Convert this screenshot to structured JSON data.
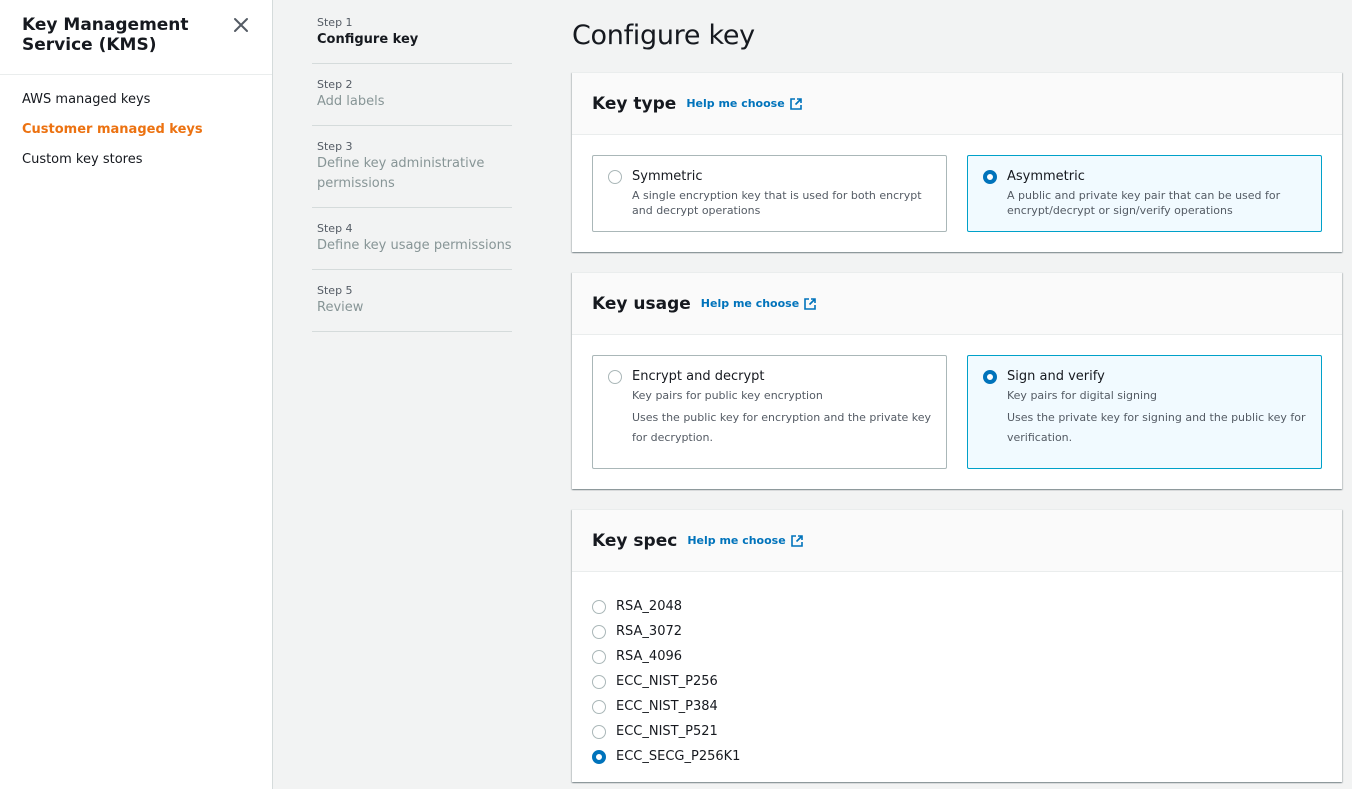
{
  "sidebar": {
    "title": "Key Management Service (KMS)",
    "items": [
      {
        "label": "AWS managed keys",
        "active": false
      },
      {
        "label": "Customer managed keys",
        "active": true
      },
      {
        "label": "Custom key stores",
        "active": false
      }
    ],
    "close_icon": "close-icon"
  },
  "steps": [
    {
      "num": "Step 1",
      "label": "Configure key",
      "current": true
    },
    {
      "num": "Step 2",
      "label": "Add labels",
      "current": false
    },
    {
      "num": "Step 3",
      "label": "Define key administrative permissions",
      "current": false
    },
    {
      "num": "Step 4",
      "label": "Define key usage permissions",
      "current": false
    },
    {
      "num": "Step 5",
      "label": "Review",
      "current": false
    }
  ],
  "page_title": "Configure key",
  "key_type": {
    "title": "Key type",
    "help": "Help me choose",
    "options": [
      {
        "title": "Symmetric",
        "desc": "A single encryption key that is used for both encrypt and decrypt operations",
        "selected": false
      },
      {
        "title": "Asymmetric",
        "desc": "A public and private key pair that can be used for encrypt/decrypt or sign/verify operations",
        "selected": true
      }
    ]
  },
  "key_usage": {
    "title": "Key usage",
    "help": "Help me choose",
    "options": [
      {
        "title": "Encrypt and decrypt",
        "desc": "Key pairs for public key encryption",
        "desc2": "Uses the public key for encryption and the private key for decryption.",
        "selected": false
      },
      {
        "title": "Sign and verify",
        "desc": "Key pairs for digital signing",
        "desc2": "Uses the private key for signing and the public key for verification.",
        "selected": true
      }
    ]
  },
  "key_spec": {
    "title": "Key spec",
    "help": "Help me choose",
    "options": [
      {
        "label": "RSA_2048",
        "selected": false
      },
      {
        "label": "RSA_3072",
        "selected": false
      },
      {
        "label": "RSA_4096",
        "selected": false
      },
      {
        "label": "ECC_NIST_P256",
        "selected": false
      },
      {
        "label": "ECC_NIST_P384",
        "selected": false
      },
      {
        "label": "ECC_NIST_P521",
        "selected": false
      },
      {
        "label": "ECC_SECG_P256K1",
        "selected": true
      }
    ]
  },
  "colors": {
    "accent_orange": "#ec7211",
    "link_blue": "#0073bb",
    "selected_border": "#00a1c9",
    "selected_bg": "#f1faff"
  }
}
